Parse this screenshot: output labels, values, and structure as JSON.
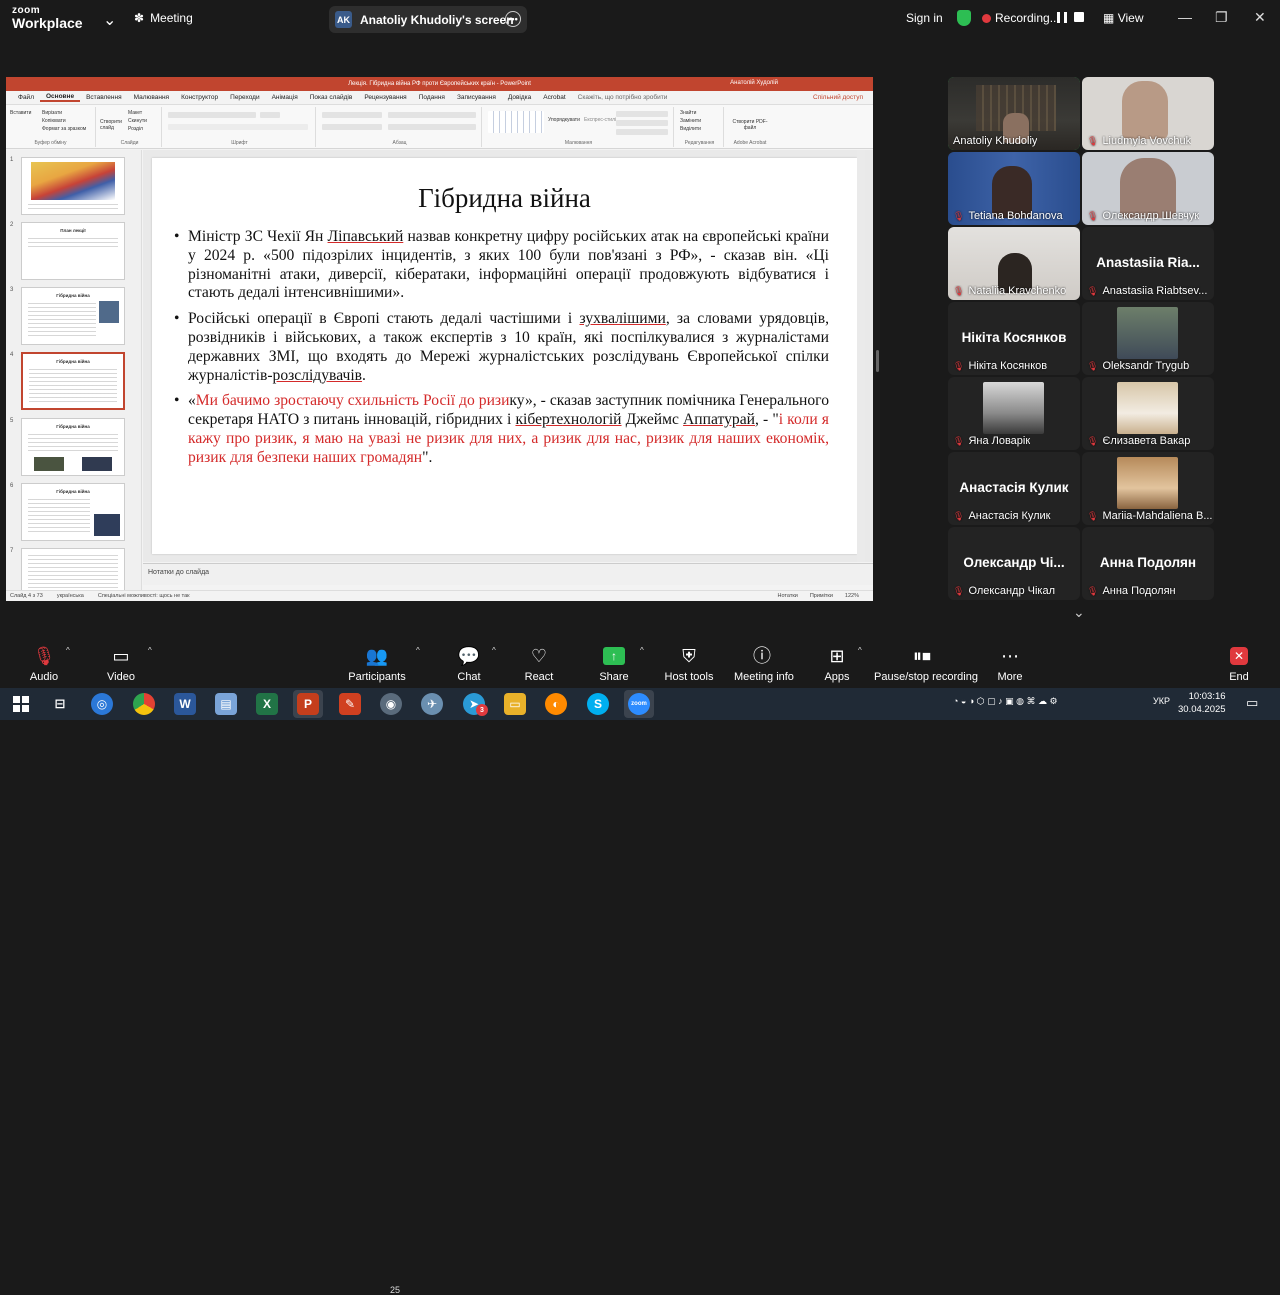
{
  "zoom": {
    "logo_top": "zoom",
    "logo_bottom": "Workplace",
    "meeting_label": "Meeting",
    "share_initials": "AK",
    "share_label": "Anatoliy Khudoliy's screen",
    "sign_in": "Sign in",
    "recording": "Recording...",
    "view": "View"
  },
  "ppt": {
    "window_title": "Лекція. Гібридна війна РФ проти Європейських країн - PowerPoint",
    "user": "Анатолій Худолій",
    "tabs": [
      "Файл",
      "Основне",
      "Вставлення",
      "Малювання",
      "Конструктор",
      "Переходи",
      "Анімація",
      "Показ слайдів",
      "Рецензування",
      "Подання",
      "Записування",
      "Довідка",
      "Acrobat"
    ],
    "tell_me": "Скажіть, що потрібно зробити",
    "share": "Спільний доступ",
    "ribbon_groups": [
      "Буфер обміну",
      "Слайди",
      "Шрифт",
      "Абзац",
      "Малювання",
      "Редагування",
      "Adobe Acrobat"
    ],
    "ribbon_items": {
      "paste": "Вставити",
      "cut": "Вирізати",
      "copy": "Копіювати",
      "format": "Формат за зразком",
      "new_slide": "Створити слайд",
      "layout": "Макет",
      "reset": "Скинути",
      "section": "Розділ",
      "arrange": "Упорядкувати",
      "quick_styles": "Експрес-стилі",
      "find": "Знайти",
      "replace": "Замінити",
      "select": "Виділити",
      "create_pdf": "Створити PDF-файл"
    },
    "thumbnails": [
      {
        "num": "1",
        "title": ""
      },
      {
        "num": "2",
        "title": "План лекції"
      },
      {
        "num": "3",
        "title": "Гібридна війна"
      },
      {
        "num": "4",
        "title": "Гібридна війна"
      },
      {
        "num": "5",
        "title": "Гібридна війна"
      },
      {
        "num": "6",
        "title": "Гібридна війна"
      },
      {
        "num": "7",
        "title": ""
      }
    ],
    "notes_placeholder": "Нотатки до слайда",
    "status": {
      "slide_of": "Слайд 4 з 73",
      "language": "українська",
      "accessibility": "Спеціальні можливості: щось не так",
      "notes": "Нотатки",
      "comments": "Примітки",
      "zoom": "122%"
    }
  },
  "slide": {
    "title": "Гібридна війна",
    "b1_part1": "Міністр ЗС Чехії Ян ",
    "b1_name": "Ліпавський",
    "b1_part2": " назвав конкретну цифру російських атак на європейські країни у 2024 р. «500 підозрілих інцидентів, з яких 100 були пов'язані з РФ», - сказав він. «Ці різноманітні атаки, диверсії, кібератаки, інформаційні операції продовжують відбуватися і стають дедалі інтенсивнішими».",
    "b2_part1": "Російські операції в Європі стають дедалі частішими і ",
    "b2_word": "зухвалішими",
    "b2_part2": ", за словами урядовців, розвідників і військових, а також експертів з 10 країн, які поспілкувалися з журналістами державних ЗМІ, що входять до Мережі журналістських розслідувань Європейської спілки журналістів-",
    "b2_word2": "розслідувачів",
    "b2_part3": ".",
    "b3_open": "«",
    "b3_red1": "Ми бачимо зростаючу схильність Росії до ризи",
    "b3_part1": "ку», - сказав заступник помічника Генерального секретаря НАТО з питань інновацій, гібридних і ",
    "b3_word": "кібертехнологій",
    "b3_part2": " Джеймс ",
    "b3_name": "Аппатурай",
    "b3_part3": ", - \"",
    "b3_red2": "і коли я кажу про ризик, я маю на увазі не ризик для них, а ризик для нас, ризик для наших економік, ризик для безпеки наших громадян",
    "b3_close": "\"."
  },
  "participants": [
    {
      "name": "Anatoliy Khudoliy",
      "big": "",
      "video": true
    },
    {
      "name": "Liudmyla Vovchuk",
      "big": "",
      "video": true
    },
    {
      "name": "Tetiana Bohdanova",
      "big": "",
      "video": true
    },
    {
      "name": "Олександр Шевчук",
      "big": "",
      "video": true
    },
    {
      "name": "Nataliia Kravchenko",
      "big": "",
      "video": true
    },
    {
      "name": "Anastasiia Riabtsev...",
      "big": "Anastasiia Ria...",
      "video": false
    },
    {
      "name": "Нікіта Косянков",
      "big": "Нікіта Косянков",
      "video": false
    },
    {
      "name": "Oleksandr Trygub",
      "big": "",
      "video": true
    },
    {
      "name": "Яна Ловарік",
      "big": "",
      "video": true
    },
    {
      "name": "Єлизавета Вакар",
      "big": "",
      "video": true
    },
    {
      "name": "Анастасія Кулик",
      "big": "Анастасія Кулик",
      "video": false
    },
    {
      "name": "Mariia-Mahdaliena B...",
      "big": "",
      "video": true
    },
    {
      "name": "Олександр Чікал",
      "big": "Олександр Чі...",
      "video": false
    },
    {
      "name": "Анна Подолян",
      "big": "Анна Подолян",
      "video": false
    }
  ],
  "toolbar": {
    "audio": "Audio",
    "video": "Video",
    "participants": "Participants",
    "participants_count": "25",
    "chat": "Chat",
    "react": "React",
    "share": "Share",
    "host_tools": "Host tools",
    "meeting_info": "Meeting info",
    "apps": "Apps",
    "pause_stop": "Pause/stop recording",
    "more": "More",
    "end": "End"
  },
  "taskbar": {
    "lang": "УКР",
    "time": "10:03:16",
    "date": "30.04.2025",
    "chrome_badge": "3"
  }
}
